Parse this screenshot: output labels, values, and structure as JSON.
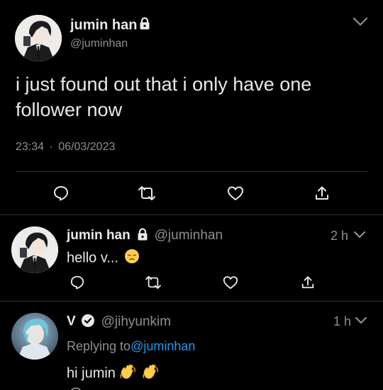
{
  "main_tweet": {
    "display_name": "jumin han",
    "handle": "@juminhan",
    "text": "i just found out that i only have one follower now",
    "time": "23:34",
    "separator": "·",
    "date": "06/03/2023"
  },
  "replies": [
    {
      "display_name": "jumin han",
      "handle": "@juminhan",
      "age": "2 h",
      "text": "hello v..."
    },
    {
      "display_name": "V",
      "handle": "@jihyunkim",
      "age": "1 h",
      "replying_prefix": "Replying to",
      "replying_to": "@juminhan",
      "text": "hi jumin"
    }
  ],
  "icons": {
    "reply": "reply-icon",
    "retweet": "retweet-icon",
    "like": "like-icon",
    "share": "share-icon",
    "more": "chevron-down-icon",
    "protected": "lock-icon",
    "verified": "verified-badge-icon"
  },
  "colors": {
    "background": "#000000",
    "text": "#e7e9ea",
    "muted": "#8b9096",
    "link": "#1d9bf0",
    "divider": "#2f3336"
  }
}
